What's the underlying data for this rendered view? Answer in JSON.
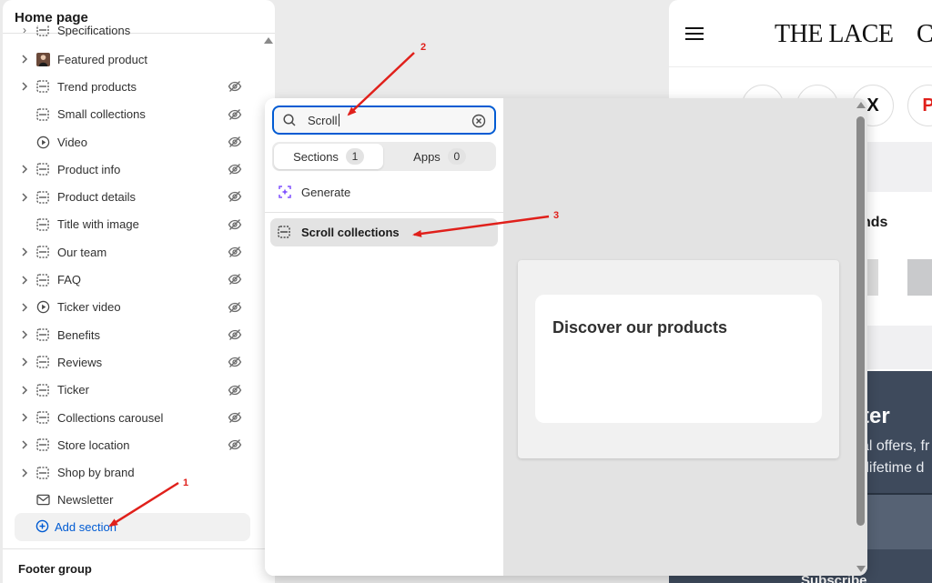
{
  "sidebar": {
    "title": "Home page",
    "partial_item": "Specifications",
    "items": [
      {
        "label": "Featured product",
        "icon": "product-thumbnail-icon",
        "chevron": true,
        "eye": false
      },
      {
        "label": "Trend products",
        "icon": "section-icon",
        "chevron": true,
        "eye": true
      },
      {
        "label": "Small collections",
        "icon": "section-icon",
        "chevron": false,
        "eye": true
      },
      {
        "label": "Video",
        "icon": "play-icon",
        "chevron": false,
        "eye": true
      },
      {
        "label": "Product info",
        "icon": "section-icon",
        "chevron": true,
        "eye": true
      },
      {
        "label": "Product details",
        "icon": "section-icon",
        "chevron": true,
        "eye": true
      },
      {
        "label": "Title with image",
        "icon": "section-icon",
        "chevron": false,
        "eye": true
      },
      {
        "label": "Our team",
        "icon": "section-icon",
        "chevron": true,
        "eye": true
      },
      {
        "label": "FAQ",
        "icon": "section-icon",
        "chevron": true,
        "eye": true
      },
      {
        "label": "Ticker video",
        "icon": "play-icon",
        "chevron": true,
        "eye": true
      },
      {
        "label": "Benefits",
        "icon": "section-icon",
        "chevron": true,
        "eye": true
      },
      {
        "label": "Reviews",
        "icon": "section-icon",
        "chevron": true,
        "eye": true
      },
      {
        "label": "Ticker",
        "icon": "section-icon",
        "chevron": true,
        "eye": true
      },
      {
        "label": "Collections carousel",
        "icon": "section-icon",
        "chevron": true,
        "eye": true
      },
      {
        "label": "Store location",
        "icon": "section-icon",
        "chevron": true,
        "eye": true
      },
      {
        "label": "Shop by brand",
        "icon": "section-icon",
        "chevron": true,
        "eye": false
      },
      {
        "label": "Newsletter",
        "icon": "mail-icon",
        "chevron": false,
        "eye": false
      }
    ],
    "add_section": "Add section",
    "footer_group": "Footer group"
  },
  "popup": {
    "search_value": "Scroll",
    "tabs": [
      {
        "label": "Sections",
        "count": "1"
      },
      {
        "label": "Apps",
        "count": "0"
      }
    ],
    "generate_label": "Generate",
    "results": [
      "Scroll collections"
    ],
    "preview_text": "Discover our products"
  },
  "store_preview": {
    "brand": "THE LACE",
    "brand_next": "C",
    "social_x": "X",
    "social_p": "P",
    "heading_partial": "nds",
    "newsletter_title_partial": "ter",
    "newsletter_line1_partial": "al offers, fr",
    "newsletter_line2_partial": "-lifetime d",
    "subscribe_partial": "Subscribe"
  },
  "annotations": [
    "1",
    "2",
    "3"
  ],
  "colors": {
    "accent": "#005bd3",
    "annotation": "#e0201b",
    "newsletter_bg": "#3e4a5c"
  }
}
